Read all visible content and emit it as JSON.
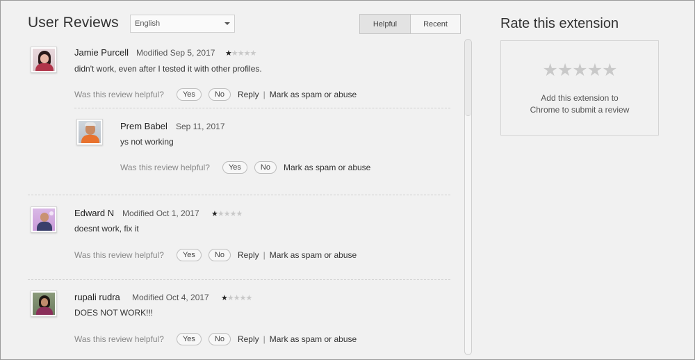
{
  "header": {
    "title": "User Reviews",
    "language": "English",
    "sort": {
      "helpful": "Helpful",
      "recent": "Recent",
      "selected": "Helpful"
    }
  },
  "reviews": [
    {
      "name": "Jamie Purcell",
      "date": "Modified Sep 5, 2017",
      "rating": 1,
      "text": "didn't work, even after I tested it with other profiles.",
      "helpful_q": "Was this review helpful?",
      "yes": "Yes",
      "no": "No",
      "reply": "Reply",
      "sep": "|",
      "spam": "Mark as spam or abuse"
    },
    {
      "name": "Prem Babel",
      "date": "Sep 11, 2017",
      "text": "ys not working",
      "helpful_q": "Was this review helpful?",
      "yes": "Yes",
      "no": "No",
      "spam": "Mark as spam or abuse"
    },
    {
      "name": "Edward N",
      "date": "Modified Oct 1, 2017",
      "rating": 1,
      "text": "doesnt work, fix it",
      "helpful_q": "Was this review helpful?",
      "yes": "Yes",
      "no": "No",
      "reply": "Reply",
      "sep": "|",
      "spam": "Mark as spam or abuse"
    },
    {
      "name": "rupali rudra",
      "date": "Modified Oct 4, 2017",
      "rating": 1,
      "text": "DOES NOT WORK!!!",
      "helpful_q": "Was this review helpful?",
      "yes": "Yes",
      "no": "No",
      "reply": "Reply",
      "sep": "|",
      "spam": "Mark as spam or abuse"
    }
  ],
  "rate": {
    "title": "Rate this extension",
    "stars": "★★★★★",
    "message_line1": "Add this extension to",
    "message_line2": "Chrome to submit a review"
  },
  "icons": {
    "rating_star": "star-icon",
    "dropdown": "chevron-down-icon"
  }
}
